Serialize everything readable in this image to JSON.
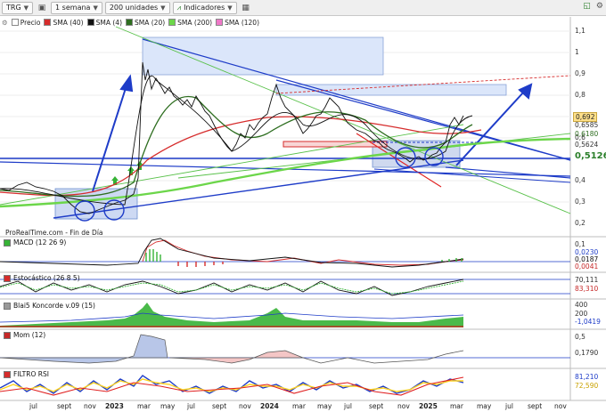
{
  "toolbar": {
    "symbol": "TRG",
    "period": "1 semana",
    "units": "200 unidades",
    "indicators_label": "Indicadores"
  },
  "legend": [
    {
      "label": "Precio",
      "color": "#ffffff"
    },
    {
      "label": "SMA (40)",
      "color": "#d62c2c"
    },
    {
      "label": "SMA (4)",
      "color": "#111111"
    },
    {
      "label": "SMA (20)",
      "color": "#2e6e20"
    },
    {
      "label": "SMA (200)",
      "color": "#6cd64a"
    },
    {
      "label": "SMA (120)",
      "color": "#ef78c8"
    }
  ],
  "price_axis": [
    "1,1",
    "1",
    "0,9",
    "0,8",
    "0,7",
    "0,6",
    "0,5",
    "0,4",
    "0,3",
    "0,2"
  ],
  "price_badges": [
    {
      "text": "0,692",
      "bg": "#ffe08a",
      "fg": "#111111"
    },
    {
      "text": "0,6585",
      "bg": "#ffffff",
      "fg": "#333333"
    },
    {
      "text": "0,6180",
      "bg": "#ffffff",
      "fg": "#2e6e20"
    },
    {
      "text": "0,5624",
      "bg": "#ffffff",
      "fg": "#333333"
    },
    {
      "text": "0,5126",
      "bg": "#ffffff",
      "fg": "#2a7f2a"
    }
  ],
  "source_note": "ProRealTime.com - Fin de Día",
  "panels": {
    "macd": {
      "title": "MACD (12 26 9)",
      "axis": [
        "0,1",
        "0"
      ],
      "badges": [
        "0,0230",
        "0,0187",
        "0,0041"
      ]
    },
    "stoch": {
      "title": "Estocástico (26 8 5)",
      "badges": [
        "70,111",
        "83,310"
      ]
    },
    "blai5": {
      "title": "Blai5 Koncorde v.09 (15)",
      "axis": [
        "400",
        "200",
        "0"
      ],
      "badges": [
        "-1,0419"
      ]
    },
    "mom": {
      "title": "Mom (12)",
      "axis": [
        "0,5"
      ],
      "badges": [
        "0,1790"
      ]
    },
    "rsi": {
      "title": "FILTRO RSI",
      "badges": [
        "81,210",
        "72,590"
      ]
    }
  },
  "x_axis": [
    "jul",
    "sept",
    "nov",
    "2023",
    "mar",
    "may",
    "jul",
    "sept",
    "nov",
    "2024",
    "mar",
    "may",
    "jul",
    "sept",
    "nov",
    "2025",
    "mar",
    "may",
    "jul",
    "sept",
    "nov"
  ],
  "colors": {
    "up": "#2a7f2a",
    "down": "#c62828",
    "trend_blue": "#1e3cc8",
    "rect_fill": "#dbe6fa"
  }
}
